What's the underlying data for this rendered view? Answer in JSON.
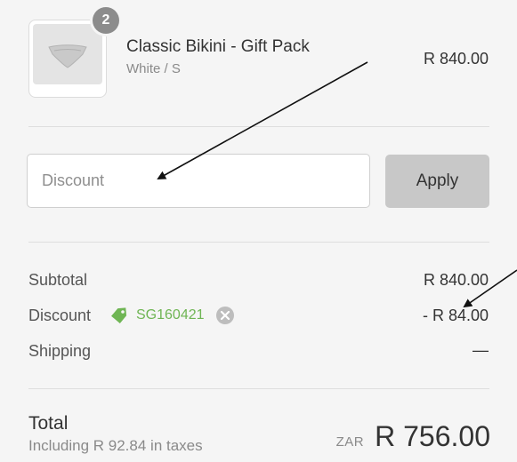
{
  "cart_item": {
    "quantity": "2",
    "name": "Classic Bikini - Gift Pack",
    "variant": "White / S",
    "price": "R 840.00",
    "image_icon": "bikini-bottom-thumbnail"
  },
  "discount_form": {
    "placeholder": "Discount",
    "value": "",
    "apply_label": "Apply"
  },
  "summary": {
    "subtotal_label": "Subtotal",
    "subtotal_value": "R 840.00",
    "discount_label": "Discount",
    "discount_code": "SG160421",
    "discount_value": "- R 84.00",
    "shipping_label": "Shipping",
    "shipping_value": "—"
  },
  "total": {
    "label": "Total",
    "tax_note": "Including R 92.84 in taxes",
    "currency": "ZAR",
    "amount": "R 756.00"
  },
  "colors": {
    "background": "#f5f5f5",
    "discount_code_green": "#6fb554",
    "apply_button": "#c8c8c8",
    "badge": "#8c8c8c"
  }
}
